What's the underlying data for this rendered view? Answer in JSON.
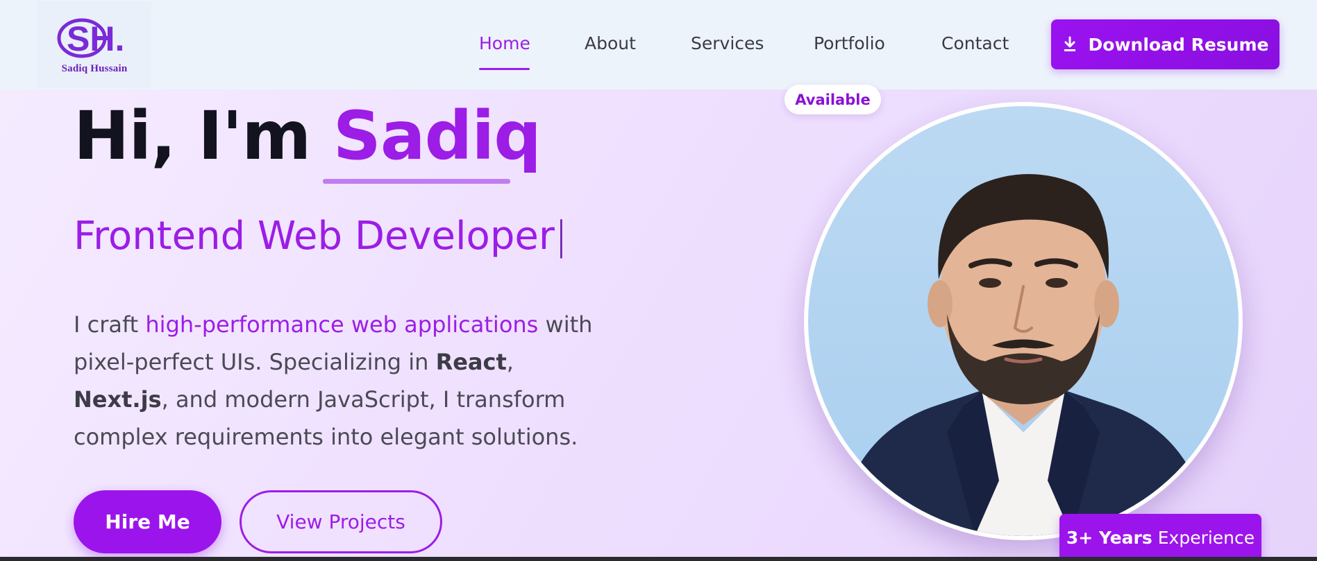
{
  "brand": {
    "logo_mark": "SH.",
    "logo_name": "Sadiq Hussain"
  },
  "nav": {
    "items": [
      {
        "label": "Home",
        "active": true
      },
      {
        "label": "About",
        "active": false
      },
      {
        "label": "Services",
        "active": false
      },
      {
        "label": "Portfolio",
        "active": false
      },
      {
        "label": "Contact",
        "active": false
      }
    ],
    "download_label": "Download Resume",
    "download_icon": "download-icon"
  },
  "hero": {
    "greeting": "Hi, I'm ",
    "name": "Sadiq",
    "role": "Frontend Web Developer",
    "caret": "|",
    "desc": {
      "p1": "I craft ",
      "highlight": "high-performance web applications",
      "p2": " with pixel-perfect UIs. Specializing in ",
      "tech1": "React",
      "p3": ", ",
      "tech2": "Next.js",
      "p4": ", and modern JavaScript, I transform complex requirements into elegant solutions."
    },
    "hire_label": "Hire Me",
    "projects_label": "View Projects"
  },
  "profile": {
    "available_label": "Available",
    "exp_bold": "3+ Years",
    "exp_rest": "Experience"
  },
  "colors": {
    "accent": "#9c1de6",
    "header_bg": "#edf3fb",
    "hero_bg": "#efe0ff",
    "text_dark": "#12131f"
  }
}
